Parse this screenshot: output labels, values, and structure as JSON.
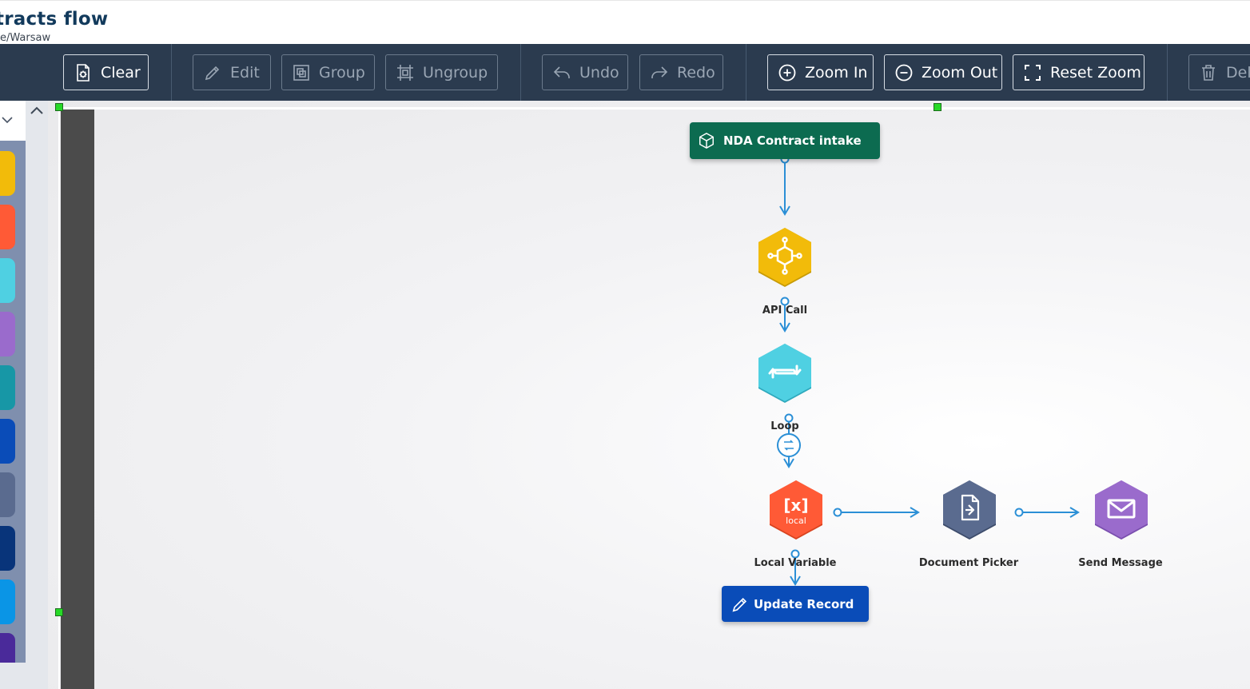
{
  "header": {
    "title": "tracts flow",
    "timezone": "e/Warsaw"
  },
  "toolbar": {
    "clear_label": "Clear",
    "edit_label": "Edit",
    "group_label": "Group",
    "ungroup_label": "Ungroup",
    "undo_label": "Undo",
    "redo_label": "Redo",
    "zoom_in_label": "Zoom In",
    "zoom_out_label": "Zoom Out",
    "reset_zoom_label": "Reset Zoom",
    "delete_label": "Del"
  },
  "palette": {
    "tiles": [
      {
        "icon": "api-call-icon",
        "color": "#f2bb0a"
      },
      {
        "icon": "local-variable-icon",
        "color": "#ff5a36"
      },
      {
        "icon": "loop-icon",
        "color": "#4fd0e2"
      },
      {
        "icon": "send-message-icon",
        "color": "#9a6bcc"
      },
      {
        "icon": "teal-action-icon",
        "color": "#1797a6"
      },
      {
        "icon": "update-record-icon",
        "color": "#0a4cb8"
      },
      {
        "icon": "document-picker-icon",
        "color": "#5a6b8f"
      },
      {
        "icon": "navy-action-icon",
        "color": "#08347a"
      },
      {
        "icon": "sky-action-icon",
        "color": "#0a95e6"
      },
      {
        "icon": "indigo-action-icon",
        "color": "#4a2a9a"
      }
    ]
  },
  "flow": {
    "start": {
      "label": "NDA Contract intake",
      "icon": "cube-icon",
      "color": "#0c6b50"
    },
    "nodes": [
      {
        "id": "api-call",
        "label": "API Call",
        "icon": "api-hub-icon",
        "color": "#f2bb0a"
      },
      {
        "id": "loop",
        "label": "Loop",
        "icon": "repeat-icon",
        "color": "#4fd0e2"
      },
      {
        "id": "local-variable",
        "label": "Local Variable",
        "icon": "variable-x-icon",
        "color": "#ff5a36",
        "icon_text": "[x]",
        "icon_subtext": "local"
      },
      {
        "id": "document-picker",
        "label": "Document Picker",
        "icon": "document-icon",
        "color": "#5a6b8f"
      },
      {
        "id": "send-message",
        "label": "Send Message",
        "icon": "envelope-icon",
        "color": "#9a6bcc"
      }
    ],
    "action": {
      "label": "Update Record",
      "icon": "pencil-icon",
      "color": "#0a4cb8"
    },
    "edge_color": "#2b8fd6"
  }
}
